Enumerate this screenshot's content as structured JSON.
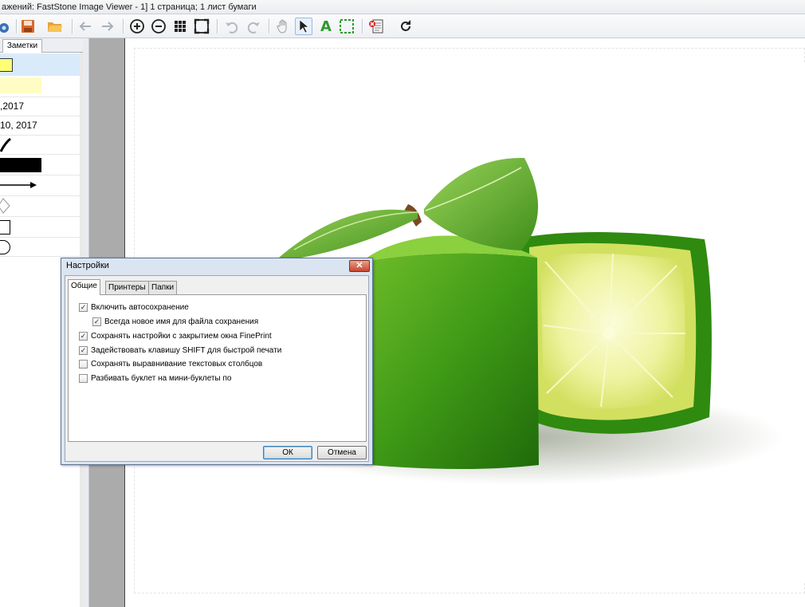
{
  "window": {
    "title": "ажений: FastStone Image Viewer - 1] 1 страница; 1 лист бумаги"
  },
  "toolbar": {
    "buttons": [
      {
        "name": "printer-settings-icon"
      },
      {
        "name": "save-icon"
      },
      {
        "name": "open-folder-icon"
      },
      {
        "name": "back-arrow-icon"
      },
      {
        "name": "forward-arrow-icon"
      },
      {
        "name": "zoom-in-icon"
      },
      {
        "name": "zoom-out-icon"
      },
      {
        "name": "grid-icon"
      },
      {
        "name": "fit-page-icon"
      },
      {
        "name": "undo-icon"
      },
      {
        "name": "redo-icon"
      },
      {
        "name": "hand-icon"
      },
      {
        "name": "select-arrow-icon"
      },
      {
        "name": "text-tool-icon"
      },
      {
        "name": "selection-rect-icon"
      },
      {
        "name": "delete-page-icon"
      },
      {
        "name": "rotate-icon"
      }
    ],
    "text_tool_label": "A"
  },
  "left_panel": {
    "tab_label": "Заметки",
    "items": [
      {
        "text": ""
      },
      {
        "text": ""
      },
      {
        "text": ",2017"
      },
      {
        "text": "10, 2017"
      },
      {
        "text": ""
      },
      {
        "text": ""
      },
      {
        "text": ""
      },
      {
        "text": ""
      },
      {
        "text": ""
      },
      {
        "text": ""
      }
    ]
  },
  "dialog": {
    "title": "Настройки",
    "close_label": "✕",
    "tabs": [
      "Общие",
      "Принтеры",
      "Папки"
    ],
    "options": [
      {
        "label": "Включить автосохранение",
        "checked": true
      },
      {
        "label": "Всегда новое имя для файла сохранения",
        "checked": true
      },
      {
        "label": "Сохранять настройки с закрытием окна FinePrint",
        "checked": true
      },
      {
        "label": "Задействовать клавишу SHIFT для быстрой печати",
        "checked": true
      },
      {
        "label": "Сохранять выравнивание текстовых столбцов",
        "checked": false
      },
      {
        "label": "Разбивать буклет на мини-буклеты по",
        "checked": false
      }
    ],
    "ok_label": "ОК",
    "cancel_label": "Отмена"
  },
  "colors": {
    "lime_dark": "#2f7d12",
    "lime_mid": "#4fa81b",
    "lime_light": "#cfe56b",
    "pulp": "#eef3a0"
  }
}
